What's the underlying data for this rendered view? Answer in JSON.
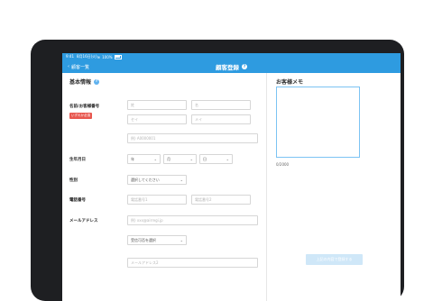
{
  "status_bar": {
    "time": "9:41",
    "date": "8月16日(火)",
    "battery": "100%"
  },
  "nav": {
    "back_label": "顧客一覧",
    "title": "顧客登録",
    "help_icon": "?"
  },
  "basic_info": {
    "title": "基本情報",
    "help_icon": "?",
    "name_label": "名前/お客様番号",
    "required_badge": "いずれか必須",
    "last_name_placeholder": "姓",
    "first_name_placeholder": "名",
    "last_kana_placeholder": "セイ",
    "first_kana_placeholder": "メイ",
    "customer_no_placeholder": "例) A0000001",
    "birthdate_label": "生年月日",
    "year_label": "年",
    "month_label": "月",
    "day_label": "日",
    "gender_label": "性別",
    "gender_select": "選択してください",
    "phone_label": "電話番号",
    "phone1_placeholder": "電話番号1",
    "phone2_placeholder": "電話番号2",
    "email_label": "メールアドレス",
    "email_placeholder": "例) xxx@airregi.jp",
    "email_select": "受信可否を選択",
    "email2_placeholder": "メールアドレス2"
  },
  "memo": {
    "title": "お客様メモ",
    "counter": "0/2000"
  },
  "submit_label": "上記の内容で登録する"
}
